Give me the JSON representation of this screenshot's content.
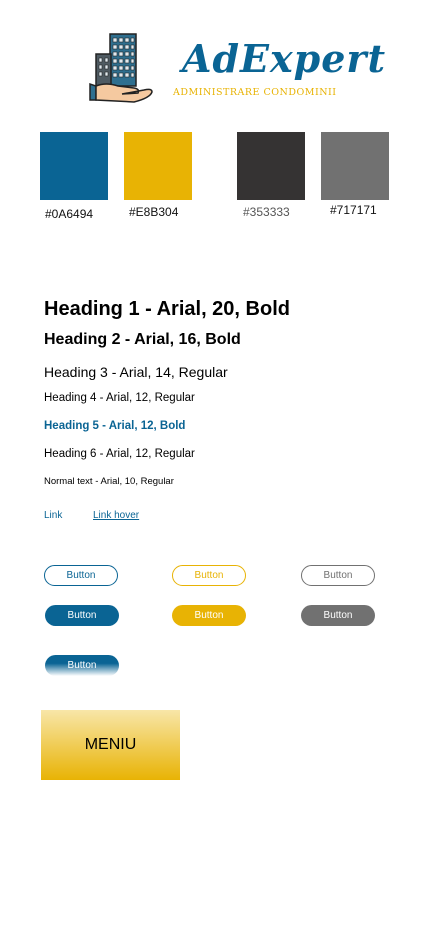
{
  "brand": {
    "name": "AdExpert",
    "tagline": "ADMINISTRARE CONDOMINII"
  },
  "colors": [
    {
      "hex": "#0A6494",
      "label": "#0A6494"
    },
    {
      "hex": "#E8B304",
      "label": "#E8B304"
    },
    {
      "hex": "#353333",
      "label": "#353333"
    },
    {
      "hex": "#717171",
      "label": "#717171"
    }
  ],
  "typography": {
    "h1": "Heading 1 - Arial, 20, Bold",
    "h2": "Heading 2 - Arial, 16, Bold",
    "h3": "Heading 3 - Arial, 14, Regular",
    "h4": "Heading 4 - Arial, 12, Regular",
    "h5": "Heading 5 - Arial, 12, Bold",
    "h6": "Heading 6 - Arial, 12, Regular",
    "normal": "Normal text - Arial, 10, Regular"
  },
  "links": {
    "link": "Link",
    "link_hover": "Link hover"
  },
  "buttons": {
    "outline_blue": "Button",
    "outline_yellow": "Button",
    "outline_gray": "Button",
    "filled_blue": "Button",
    "filled_yellow": "Button",
    "filled_gray": "Button",
    "gradient_blue": "Button"
  },
  "menu": {
    "label": "MENIU"
  }
}
